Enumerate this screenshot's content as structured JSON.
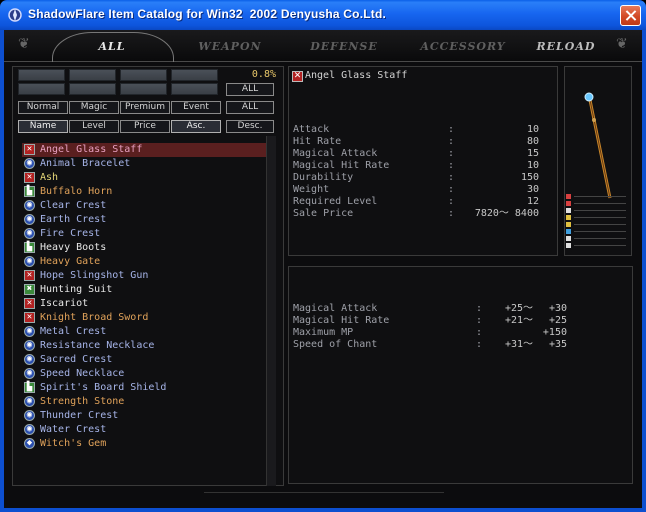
{
  "window": {
    "title": "ShadowFlare Item Catalog for Win32  2002 Denyusha Co.Ltd."
  },
  "tabs": [
    {
      "label": "ALL",
      "active": true
    },
    {
      "label": "WEAPON",
      "active": false
    },
    {
      "label": "DEFENSE",
      "active": false
    },
    {
      "label": "ACCESSORY",
      "active": false
    },
    {
      "label": "RELOAD",
      "active": false
    }
  ],
  "filters": {
    "percent": "0.8%",
    "all_top": "ALL",
    "rarity": [
      "Normal",
      "Magic",
      "Premium",
      "Event"
    ],
    "all_rarity": "ALL",
    "sort": [
      "Name",
      "Level",
      "Price"
    ],
    "asc": "Asc.",
    "desc": "Desc."
  },
  "items": [
    {
      "name": "Angel Glass Staff",
      "icon": "staff-icon",
      "color": "pink",
      "selected": true
    },
    {
      "name": "Animal Bracelet",
      "icon": "crest-icon",
      "color": "blue"
    },
    {
      "name": "Ash",
      "icon": "staff-icon",
      "color": "yellow"
    },
    {
      "name": "Buffalo Horn",
      "icon": "boots-icon",
      "color": "orange"
    },
    {
      "name": "Clear Crest",
      "icon": "crest-icon",
      "color": "blue"
    },
    {
      "name": "Earth Crest",
      "icon": "crest-icon",
      "color": "blue"
    },
    {
      "name": "Fire Crest",
      "icon": "crest-icon",
      "color": "blue"
    },
    {
      "name": "Heavy Boots",
      "icon": "boots-icon",
      "color": "white"
    },
    {
      "name": "Heavy Gate",
      "icon": "crest-icon",
      "color": "orange"
    },
    {
      "name": "Hope Slingshot Gun",
      "icon": "staff-icon",
      "color": "blue"
    },
    {
      "name": "Hunting Suit",
      "icon": "suit-icon",
      "color": "white"
    },
    {
      "name": "Iscariot",
      "icon": "staff-icon",
      "color": "white"
    },
    {
      "name": "Knight Broad Sword",
      "icon": "staff-icon",
      "color": "orange"
    },
    {
      "name": "Metal Crest",
      "icon": "crest-icon",
      "color": "blue"
    },
    {
      "name": "Resistance Necklace",
      "icon": "crest-icon",
      "color": "blue"
    },
    {
      "name": "Sacred Crest",
      "icon": "crest-icon",
      "color": "blue"
    },
    {
      "name": "Speed Necklace",
      "icon": "crest-icon",
      "color": "blue"
    },
    {
      "name": "Spirit's Board Shield",
      "icon": "boots-icon",
      "color": "blue"
    },
    {
      "name": "Strength Stone",
      "icon": "crest-icon",
      "color": "orange"
    },
    {
      "name": "Thunder Crest",
      "icon": "crest-icon",
      "color": "blue"
    },
    {
      "name": "Water Crest",
      "icon": "crest-icon",
      "color": "blue"
    },
    {
      "name": "Witch's Gem",
      "icon": "gem-icon",
      "color": "orange"
    }
  ],
  "detail": {
    "name": "Angel Glass Staff",
    "stats": [
      {
        "label": "Attack",
        "value": "10"
      },
      {
        "label": "Hit Rate",
        "value": "80"
      },
      {
        "label": "Magical Attack",
        "value": "15"
      },
      {
        "label": "Magical Hit Rate",
        "value": "10"
      },
      {
        "label": "Durability",
        "value": "150"
      },
      {
        "label": "Weight",
        "value": "30"
      },
      {
        "label": "Required Level",
        "value": "12"
      },
      {
        "label": "Sale Price",
        "value": "7820～  8400"
      }
    ],
    "separator": ":",
    "bonuses": [
      {
        "label": "Magical Attack",
        "min": "+25～",
        "max": "+30"
      },
      {
        "label": "Magical Hit Rate",
        "min": "+21～",
        "max": "+25"
      },
      {
        "label": "Maximum MP",
        "min": "",
        "max": "+150"
      },
      {
        "label": "Speed of Chant",
        "min": "+31～",
        "max": "+35"
      }
    ]
  },
  "swatches": [
    "#d84040",
    "#d84040",
    "#e0e0e0",
    "#e0c040",
    "#e0c040",
    "#40a0e0",
    "#e0e0e0",
    "#e0e0e0"
  ]
}
